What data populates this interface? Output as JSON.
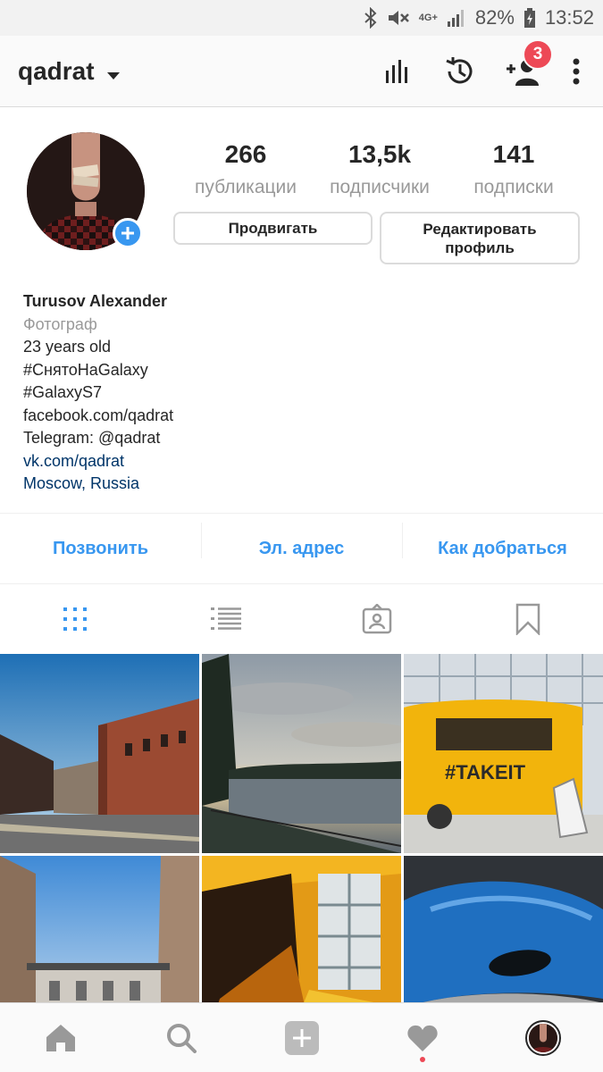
{
  "status_bar": {
    "battery": "82%",
    "time": "13:52",
    "network": "4G+",
    "icons": [
      "bluetooth-icon",
      "mute-icon",
      "signal-icon",
      "battery-icon"
    ]
  },
  "app_bar": {
    "username": "qadrat",
    "notification_count": "3",
    "icons": [
      "insights-icon",
      "archive-icon",
      "add-person-icon",
      "more-icon"
    ]
  },
  "profile": {
    "stats": [
      {
        "value": "266",
        "label": "публикации"
      },
      {
        "value": "13,5k",
        "label": "подписчики"
      },
      {
        "value": "141",
        "label": "подписки"
      }
    ],
    "promote_label": "Продвигать",
    "edit_label": "Редактировать профиль"
  },
  "bio": {
    "name": "Turusov Alexander",
    "category": "Фотограф",
    "lines": [
      "23 years old",
      "#СнятоНаGalaxy",
      "#GalaxyS7",
      "facebook.com/qadrat",
      "Telegram: @qadrat"
    ],
    "website": "vk.com/qadrat",
    "location": "Moscow, Russia"
  },
  "contacts": {
    "call": "Позвонить",
    "email": "Эл. адрес",
    "directions": "Как добраться"
  },
  "tabs": [
    "grid-icon",
    "list-icon",
    "tagged-icon",
    "saved-icon"
  ],
  "photos": [
    {
      "caption": "brick building under blue sky"
    },
    {
      "caption": "lake at sunset"
    },
    {
      "caption": "#TAKEIT"
    },
    {
      "caption": "old building facade"
    },
    {
      "caption": "orange interior"
    },
    {
      "caption": "blue car"
    }
  ],
  "bottom_nav": [
    "home-icon",
    "search-icon",
    "add-post-icon",
    "activity-icon",
    "profile-avatar"
  ],
  "colors": {
    "accent": "#3897f0",
    "badge": "#ed4956",
    "link": "#003569",
    "muted": "#999999"
  }
}
